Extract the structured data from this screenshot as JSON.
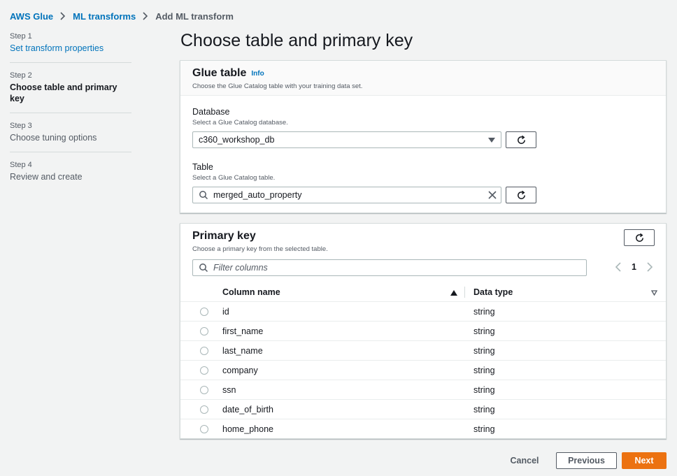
{
  "breadcrumb": {
    "items": [
      "AWS Glue",
      "ML transforms",
      "Add ML transform"
    ]
  },
  "steps": [
    {
      "num": "Step 1",
      "label": "Set transform properties",
      "state": "link"
    },
    {
      "num": "Step 2",
      "label": "Choose table and primary key",
      "state": "active"
    },
    {
      "num": "Step 3",
      "label": "Choose tuning options",
      "state": "inactive"
    },
    {
      "num": "Step 4",
      "label": "Review and create",
      "state": "inactive"
    }
  ],
  "page": {
    "title": "Choose table and primary key"
  },
  "glue_table": {
    "title": "Glue table",
    "info": "Info",
    "description": "Choose the Glue Catalog table with your training data set.",
    "database": {
      "label": "Database",
      "description": "Select a Glue Catalog database.",
      "value": "c360_workshop_db"
    },
    "table": {
      "label": "Table",
      "description": "Select a Glue Catalog table.",
      "value": "merged_auto_property"
    }
  },
  "primary_key": {
    "title": "Primary key",
    "description": "Choose a primary key from the selected table.",
    "filter_placeholder": "Filter columns",
    "page_number": "1",
    "columns": [
      "Column name",
      "Data type"
    ],
    "rows": [
      {
        "name": "id",
        "type": "string"
      },
      {
        "name": "first_name",
        "type": "string"
      },
      {
        "name": "last_name",
        "type": "string"
      },
      {
        "name": "company",
        "type": "string"
      },
      {
        "name": "ssn",
        "type": "string"
      },
      {
        "name": "date_of_birth",
        "type": "string"
      },
      {
        "name": "home_phone",
        "type": "string"
      }
    ]
  },
  "footer": {
    "cancel": "Cancel",
    "previous": "Previous",
    "next": "Next"
  },
  "colors": {
    "link": "#0073bb",
    "primary_button": "#ec7211",
    "background": "#f2f3f3"
  }
}
